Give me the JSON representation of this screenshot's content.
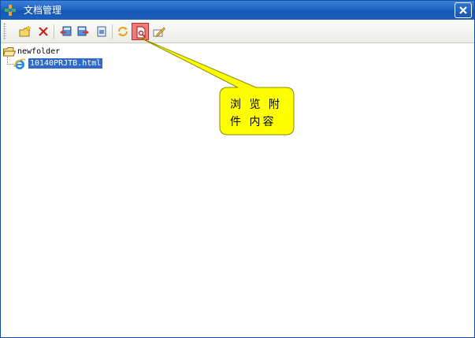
{
  "window": {
    "title": "文档管理"
  },
  "toolbar": {
    "buttons": [
      {
        "name": "new-folder-button",
        "icon": "new-folder-icon"
      },
      {
        "name": "delete-button",
        "icon": "delete-x-icon"
      },
      {
        "name": "upload-button",
        "icon": "upload-icon"
      },
      {
        "name": "download-button",
        "icon": "download-icon"
      },
      {
        "name": "copy-button",
        "icon": "document-icon"
      },
      {
        "name": "refresh-button",
        "icon": "refresh-icon"
      },
      {
        "name": "browse-attachment-button",
        "icon": "preview-icon",
        "active": true
      },
      {
        "name": "edit-button",
        "icon": "pencil-icon"
      }
    ],
    "active_color": "#f47a7a"
  },
  "tree": {
    "folder": {
      "label": "newfolder",
      "icon": "folder-icon"
    },
    "file": {
      "label": "10140PRJTB.html",
      "icon": "ie-file-icon",
      "selected": true
    }
  },
  "tooltip": {
    "text": "浏 览 附 件 内容",
    "background": "#ffff00"
  },
  "colors": {
    "titlebar": "#1f63c4",
    "selection": "#316ac5"
  }
}
